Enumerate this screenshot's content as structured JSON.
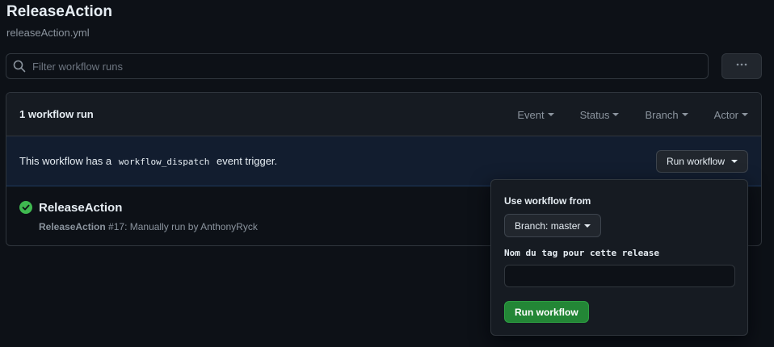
{
  "page": {
    "title": "ReleaseAction",
    "filename": "releaseAction.yml"
  },
  "search": {
    "placeholder": "Filter workflow runs",
    "icon": "search-icon"
  },
  "more_button": {
    "icon": "kebab-horizontal-icon"
  },
  "runs_box": {
    "count_label": "1 workflow run",
    "filters": [
      "Event",
      "Status",
      "Branch",
      "Actor"
    ]
  },
  "dispatch_banner": {
    "prefix": "This workflow has a",
    "code": "workflow_dispatch",
    "suffix": "event trigger.",
    "button_label": "Run workflow"
  },
  "run": {
    "status": "success",
    "status_icon": "check-circle-fill-icon",
    "name": "ReleaseAction",
    "workflow_name": "ReleaseAction",
    "details": "#17: Manually run by AnthonyRyck"
  },
  "run_dropdown": {
    "caption": "Use workflow from",
    "branch_label": "Branch: master",
    "input_label": "Nom du tag pour cette release",
    "input_value": "",
    "submit_label": "Run workflow"
  },
  "colors": {
    "background": "#0d1117",
    "success": "#3fb950",
    "primary_button": "#238636",
    "banner": "#121d2f"
  }
}
